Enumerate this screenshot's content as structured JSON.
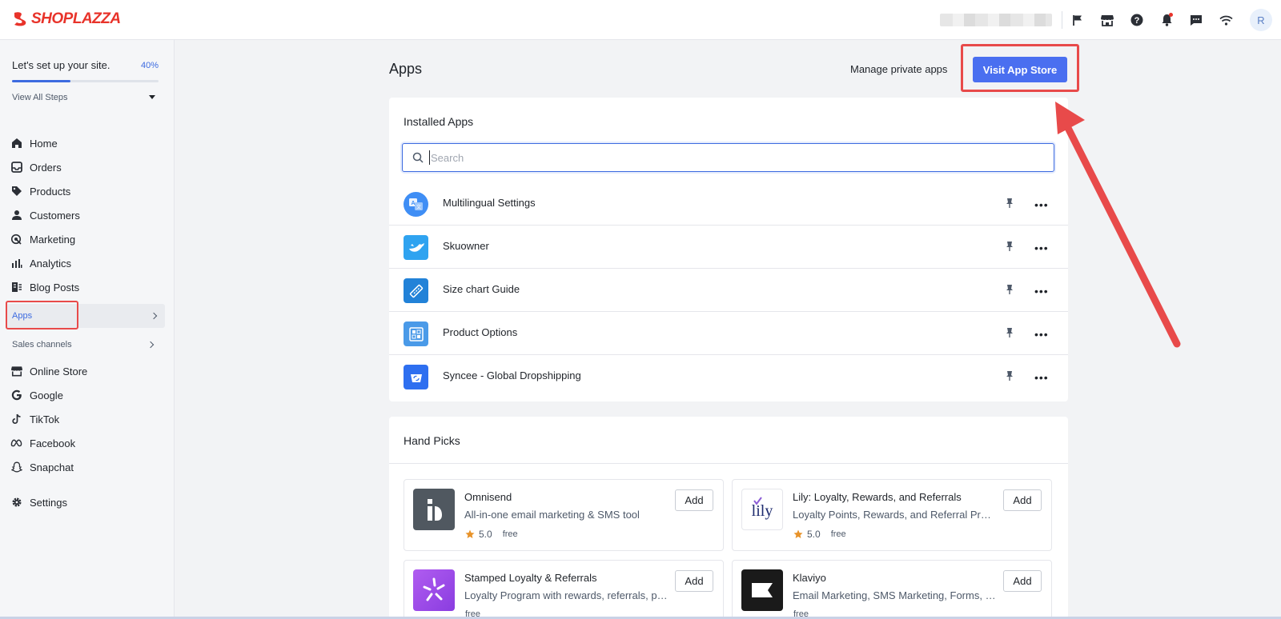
{
  "topbar": {
    "logo_text": "SHOPLAZZA",
    "avatar_initial": "R",
    "icons": [
      "flag-icon",
      "store-icon",
      "help-icon",
      "bell-icon",
      "chat-icon",
      "wifi-icon"
    ]
  },
  "sidebar": {
    "setup_title": "Let's set up your site.",
    "setup_percent_label": "40%",
    "setup_progress": 0.4,
    "view_steps": "View All Steps",
    "nav": [
      {
        "label": "Home",
        "icon": "home-icon"
      },
      {
        "label": "Orders",
        "icon": "inbox-icon"
      },
      {
        "label": "Products",
        "icon": "tag-icon"
      },
      {
        "label": "Customers",
        "icon": "person-icon"
      },
      {
        "label": "Marketing",
        "icon": "target-icon"
      },
      {
        "label": "Analytics",
        "icon": "bar-chart-icon"
      },
      {
        "label": "Blog Posts",
        "icon": "blog-icon"
      }
    ],
    "apps_label": "Apps",
    "sales_channels_label": "Sales channels",
    "channels": [
      {
        "label": "Online Store",
        "icon": "store-icon"
      },
      {
        "label": "Google",
        "icon": "google-icon"
      },
      {
        "label": "TikTok",
        "icon": "tiktok-icon"
      },
      {
        "label": "Facebook",
        "icon": "meta-icon"
      },
      {
        "label": "Snapchat",
        "icon": "snapchat-icon"
      }
    ],
    "settings_label": "Settings"
  },
  "header": {
    "title": "Apps",
    "manage_link": "Manage private apps",
    "visit_button": "Visit App Store"
  },
  "installed": {
    "title": "Installed Apps",
    "search_placeholder": "Search",
    "apps": [
      {
        "name": "Multilingual Settings",
        "icon": "translate-icon",
        "color": "#3f8ef5"
      },
      {
        "name": "Skuowner",
        "icon": "whale-icon",
        "color": "#2fa3f0"
      },
      {
        "name": "Size chart Guide",
        "icon": "ruler-icon",
        "color": "#2282d8"
      },
      {
        "name": "Product Options",
        "icon": "options-icon",
        "color": "#4a9ae8"
      },
      {
        "name": "Syncee - Global Dropshipping",
        "icon": "sync-icon",
        "color": "#2e6ff0"
      }
    ]
  },
  "handpicks": {
    "title": "Hand Picks",
    "add_label": "Add",
    "items": [
      {
        "name": "Omnisend",
        "desc": "All-in-one email marketing & SMS tool",
        "rating": "5.0",
        "price": "free",
        "logo": "omnisend-logo"
      },
      {
        "name": "Lily: Loyalty, Rewards, and Referrals",
        "desc": "Loyalty Points, Rewards, and Referral Program",
        "rating": "5.0",
        "price": "free",
        "logo": "lily-logo",
        "logo_text": "lily"
      },
      {
        "name": "Stamped Loyalty & Referrals",
        "desc": "Loyalty Program with rewards, referrals, points",
        "rating": "",
        "price": "free",
        "logo": "stamped-logo"
      },
      {
        "name": "Klaviyo",
        "desc": "Email Marketing, SMS Marketing, Forms, Reviews",
        "rating": "",
        "price": "free",
        "logo": "klaviyo-logo"
      }
    ]
  },
  "colors": {
    "accent": "#4a6ff0",
    "highlight": "#e84a4a",
    "brand": "#e8332a"
  }
}
